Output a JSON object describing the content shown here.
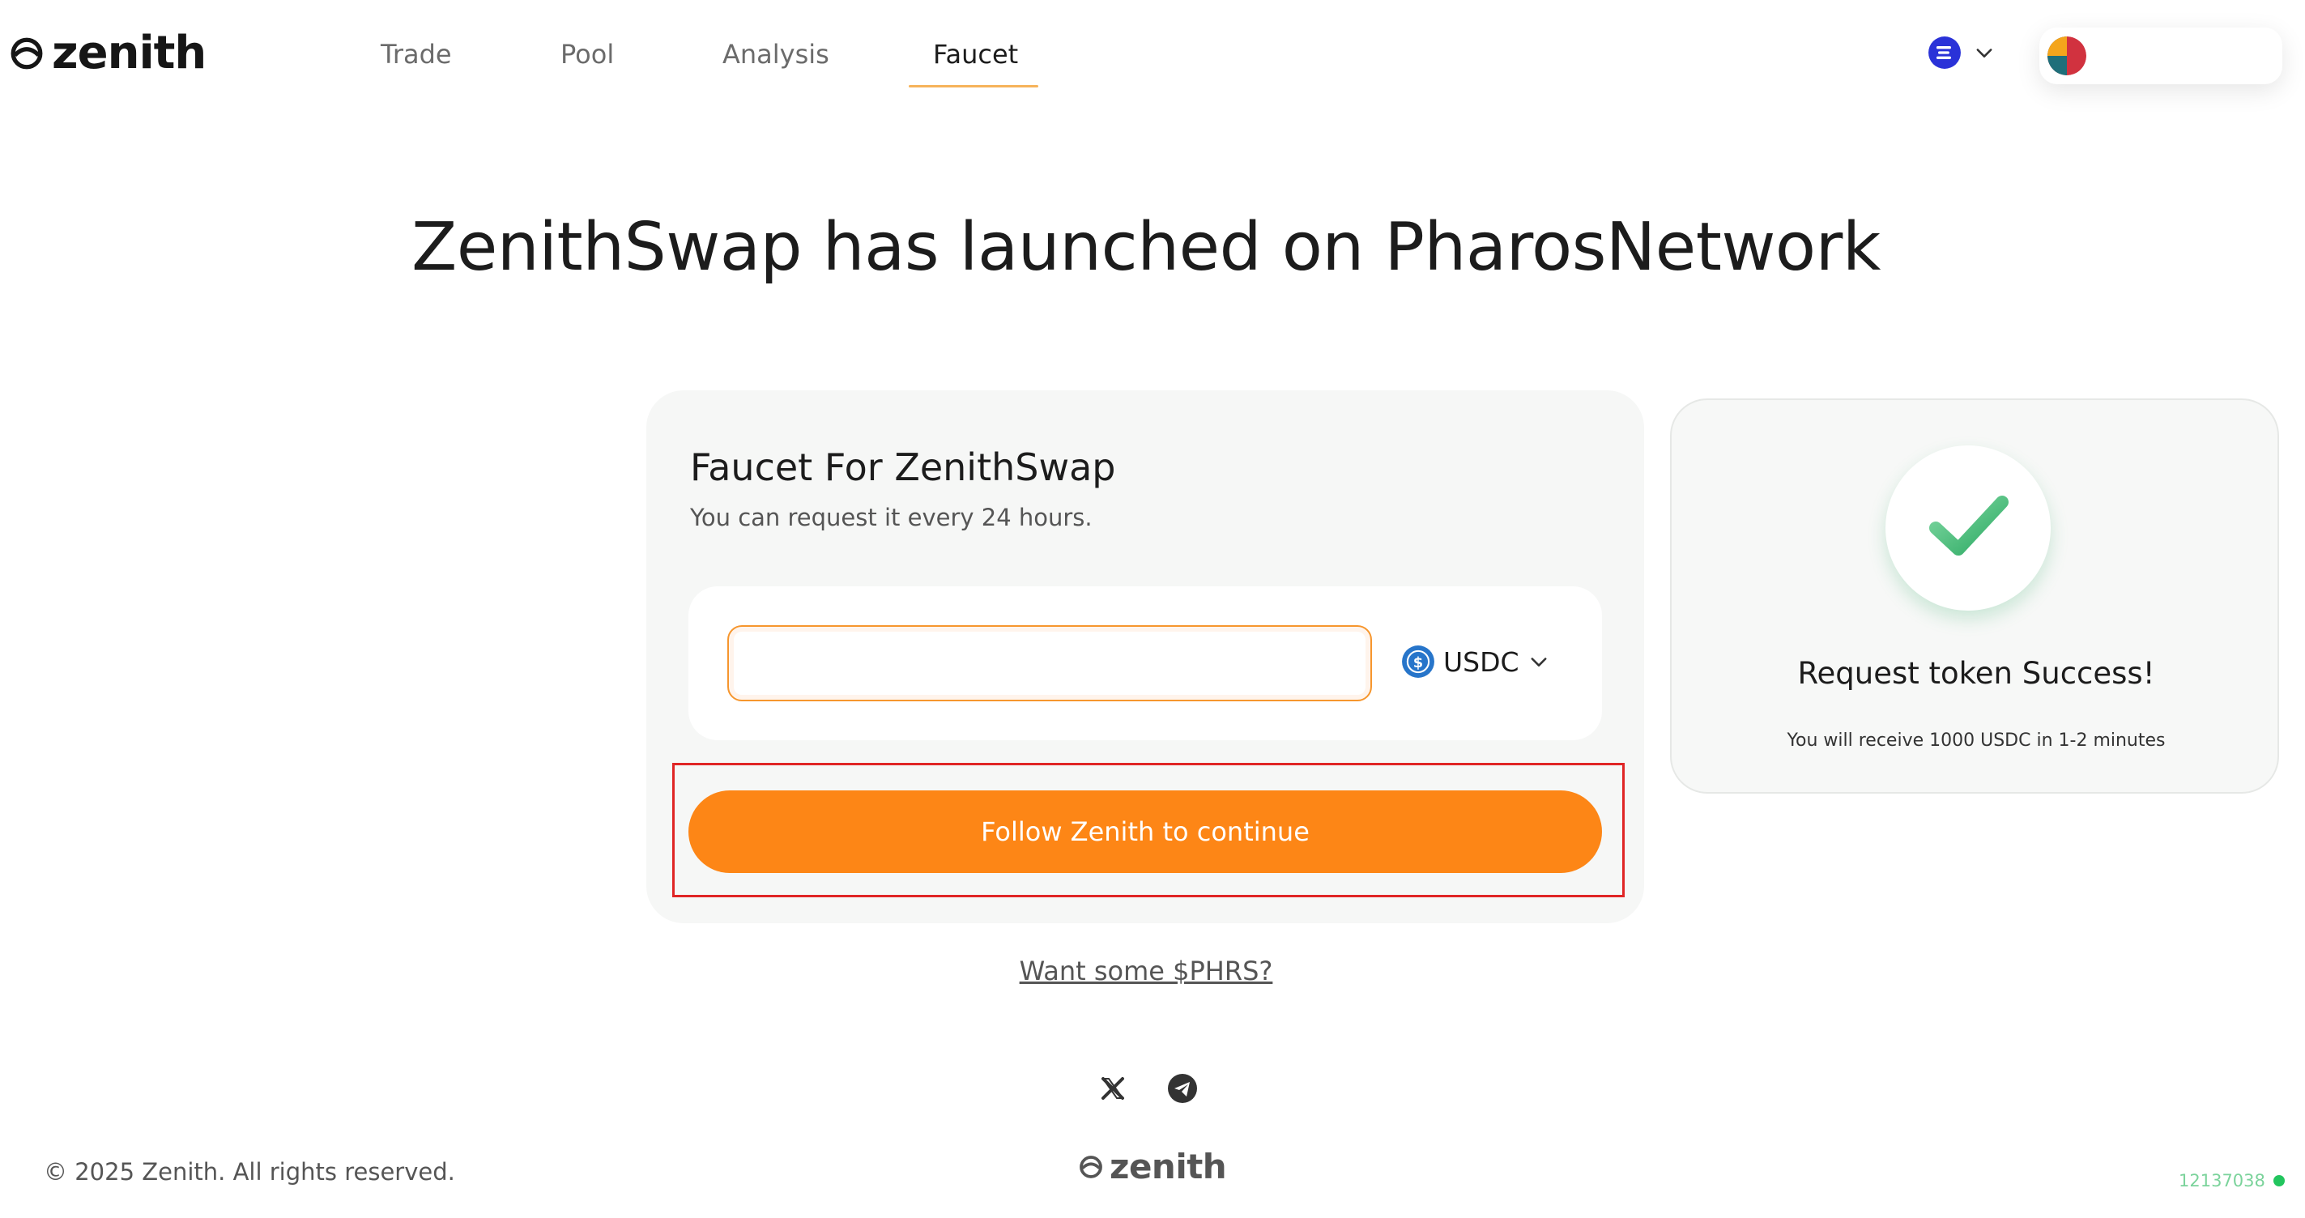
{
  "header": {
    "logo_text": "zenith",
    "nav": [
      {
        "label": "Trade"
      },
      {
        "label": "Pool"
      },
      {
        "label": "Analysis"
      },
      {
        "label": "Faucet",
        "active": true
      }
    ],
    "chain_icon": "chain-network-icon",
    "wallet_avatar": "wallet-avatar"
  },
  "hero": {
    "title": "ZenithSwap has launched on PharosNetwork"
  },
  "faucet": {
    "title": "Faucet For ZenithSwap",
    "subtitle": "You can request it every 24 hours.",
    "address_value": "",
    "token": {
      "label": "USDC",
      "icon": "usdc-icon"
    },
    "cta_label": "Follow Zenith to continue",
    "phrs_link": "Want some $PHRS?"
  },
  "success": {
    "title": "Request token Success!",
    "message": "You will receive 1000 USDC in 1-2 minutes"
  },
  "footer": {
    "copyright": "© 2025 Zenith. All rights reserved.",
    "logo_text": "zenith",
    "block_number": "12137038"
  },
  "colors": {
    "accent": "#fd8616",
    "success": "#2eaa64",
    "highlight_frame": "#e02525",
    "status_dot": "#22c55e"
  }
}
